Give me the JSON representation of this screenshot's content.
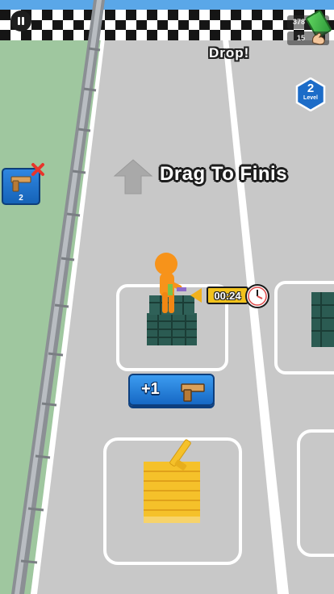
{
  "hud": {
    "cash": "378",
    "gems": "15",
    "cash_icon": "cash-icon",
    "gems_icon": "muscle-icon",
    "pause_icon": "pause-icon"
  },
  "drop_label": "Drop!",
  "level": {
    "number": "2",
    "label": "Level"
  },
  "instruction": "Drag To Finis",
  "gun_card": {
    "count": "2"
  },
  "timer": {
    "value": "00:24",
    "icon": "clock-icon"
  },
  "bonus_button": {
    "label": "+1",
    "icon": "pistol-icon"
  },
  "colors": {
    "road": "#c9c9c9",
    "grass": "#9fc79f",
    "lane_line": "#ffffff",
    "crate": "#2b5b52",
    "character": "#f7931a",
    "gold": "#f5c12a",
    "button_blue": "#1f7ad8",
    "badge_blue": "#1c6cc8"
  }
}
